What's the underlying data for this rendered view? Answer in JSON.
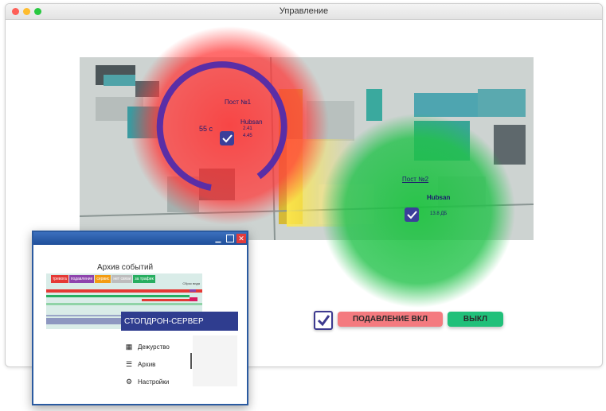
{
  "window": {
    "title": "Управление"
  },
  "map": {
    "posts": [
      {
        "name": "Пост №1",
        "device": "Hubsan",
        "distance": "55 с",
        "reading_1": "2.41",
        "reading_2": "4.45",
        "zone_color": "#ff3b3b"
      },
      {
        "name": "Пост №2",
        "device": "Hubsan",
        "distance": "13.8 ДБ",
        "zone_color": "#22c24a"
      }
    ],
    "ring_color": "#5a2ea6"
  },
  "controls": {
    "suppression_label": "ПОДАВЛЕНИЕ ВКЛ",
    "off_label": "ВЫКЛ",
    "suppression_color": "#f47a7f",
    "off_color": "#21c07a"
  },
  "archive_window": {
    "title": "Архив событий",
    "legend": [
      {
        "label": "тревога",
        "color": "#e53935"
      },
      {
        "label": "подавление",
        "color": "#8e44ad"
      },
      {
        "label": "сервис",
        "color": "#f39c12"
      },
      {
        "label": "нет связи",
        "color": "#bdbdbd"
      },
      {
        "label": "за трафик",
        "color": "#27ae60"
      }
    ],
    "reset_label": "Сброс вида",
    "server_name": "СТОПДРОН-СЕРВЕР",
    "menu": [
      {
        "label": "Дежурство",
        "icon": "dashboard-icon"
      },
      {
        "label": "Архив",
        "icon": "list-icon"
      },
      {
        "label": "Настройки",
        "icon": "gear-icon"
      }
    ]
  }
}
